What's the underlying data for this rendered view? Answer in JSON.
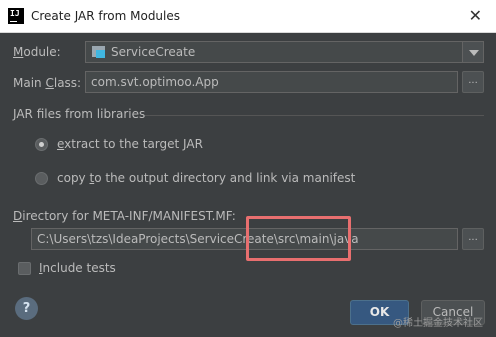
{
  "window": {
    "app_icon_text": "IJ",
    "title": "Create JAR from Modules",
    "close_symbol": "✕"
  },
  "module": {
    "label": "Module:",
    "value": "ServiceCreate"
  },
  "main_class": {
    "label": "Main Class:",
    "value": "com.svt.optimoo.App",
    "browse_label": "..."
  },
  "jar_files": {
    "section_label": "JAR files from libraries",
    "options": [
      {
        "label": "extract to the target JAR",
        "selected": true
      },
      {
        "label": "copy to the output directory and link via manifest",
        "selected": false
      }
    ]
  },
  "manifest": {
    "label": "Directory for META-INF/MANIFEST.MF:",
    "value": "C:\\Users\\tzs\\IdeaProjects\\ServiceCreate\\src\\main\\java",
    "browse_label": "..."
  },
  "include_tests": {
    "label": "Include tests",
    "checked": false
  },
  "footer": {
    "help_symbol": "?",
    "ok_label": "OK",
    "cancel_label": "Cancel"
  },
  "annotation": {
    "highlight_color": "#e86f6f"
  },
  "watermark": "@稀土掘金技术社区",
  "colors": {
    "background": "#3c3f41",
    "field": "#45494a",
    "primary_button": "#365880",
    "text": "#bbbbbb"
  }
}
